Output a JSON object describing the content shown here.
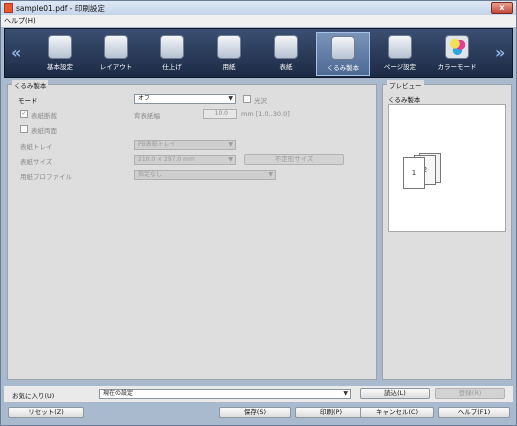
{
  "window": {
    "title": "sample01.pdf - 印刷設定",
    "close_glyph": "x"
  },
  "menu": {
    "help": "ヘルプ(H)"
  },
  "toolbar": {
    "left_arrow": "«",
    "right_arrow": "»",
    "items": [
      {
        "label": "基本設定",
        "icon": "basic-settings-icon"
      },
      {
        "label": "レイアウト",
        "icon": "layout-icon"
      },
      {
        "label": "仕上げ",
        "icon": "finishing-icon"
      },
      {
        "label": "用紙",
        "icon": "paper-icon"
      },
      {
        "label": "表紙",
        "icon": "cover-icon"
      },
      {
        "label": "くるみ製本",
        "icon": "perfect-binding-icon",
        "active": true
      },
      {
        "label": "ページ設定",
        "icon": "page-setup-icon"
      },
      {
        "label": "カラーモード",
        "icon": "color-mode-icon"
      }
    ]
  },
  "left_panel": {
    "group_title": "くるみ製本",
    "mode_label": "モード",
    "mode_value": "オフ",
    "gloss_label": "光沢",
    "cover_count_label": "表紙断裁",
    "spine_width_label": "背表紙幅",
    "spine_width_value": "10.0",
    "spine_range": "mm [1.0..30.0]",
    "cover_duplex_label": "表紙両面",
    "cover_tray_label": "表紙トレイ",
    "cover_tray_value": "PB表紙トレイ",
    "cover_size_label": "表紙サイズ",
    "cover_size_value": "210.0 × 297.0 mm",
    "irregular_size_button": "不定形サイズ",
    "paper_profile_label": "用紙プロファイル",
    "paper_profile_value": "指定なし"
  },
  "right_panel": {
    "group_title": "プレビュー",
    "subtitle": "くるみ製本",
    "page1": "1",
    "page2": "2",
    "page3": "n"
  },
  "favorites": {
    "label": "お気に入り(U)",
    "value": "現在の設定",
    "load_button": "読込(L)",
    "register_button": "登録(R)"
  },
  "bottom": {
    "reset_button": "リセット(Z)",
    "save_button": "保存(S)",
    "print_button": "印刷(P)",
    "cancel_button": "キャンセル(C)",
    "help_button": "ヘルプ(F1)"
  },
  "colors": {
    "toolbar_bg": "#1c2a44",
    "panel_bg": "#dedede",
    "frame": "#a9b9ce",
    "active_tab": "#4d6a95"
  }
}
